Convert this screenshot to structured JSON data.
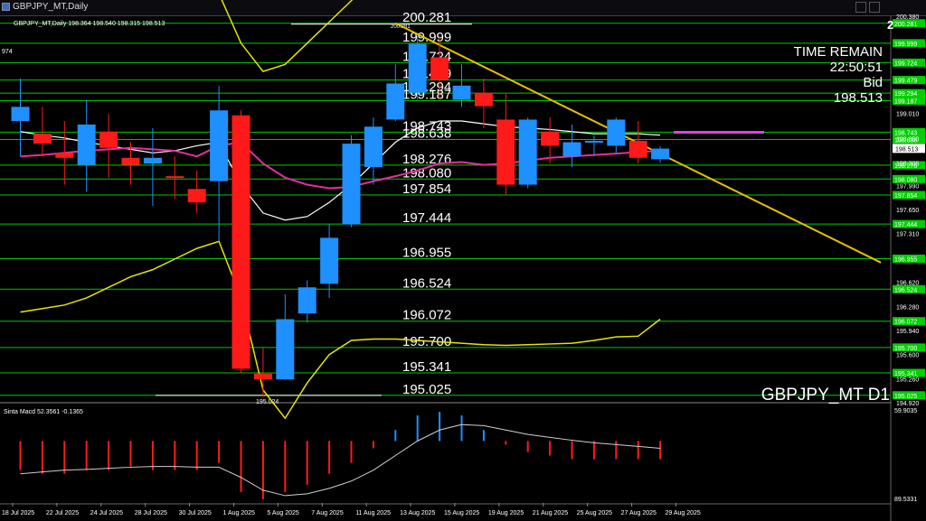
{
  "window": {
    "title": "GBPJPY_MT,Daily",
    "corner": "2"
  },
  "symbol_info": "GBPJPY_MT,Daily  198.364 198.540 198.315 198.513",
  "left_fragment": "974",
  "time_remain": {
    "label": "TIME REMAIN",
    "value": "22:50:51",
    "bid_label": "Bid",
    "bid": "198.513"
  },
  "watermark": "GBPJPY_MT D1",
  "indicator_label": "Sinta Macd 52.3561 -0.1365",
  "indicator_axis": [
    "59.9035",
    "89.5331"
  ],
  "colors": {
    "bull": "#1e90ff",
    "bear": "#ff1a1a",
    "level": "#00c800",
    "trend": "#e6c000",
    "band": "#e6e600",
    "mid": "#ffffff",
    "ma": "#e62e9e",
    "axis_bg": "#ffffff",
    "level_tag": "#00d000"
  },
  "chart_data": [
    {
      "type": "candlestick",
      "symbol": "GBPJPY_MT",
      "timeframe": "Daily",
      "x_tick_labels": [
        "18 Jul 2025",
        "22 Jul 2025",
        "24 Jul 2025",
        "28 Jul 2025",
        "30 Jul 2025",
        "1 Aug 2025",
        "5 Aug 2025",
        "7 Aug 2025",
        "11 Aug 2025",
        "13 Aug 2025",
        "15 Aug 2025",
        "19 Aug 2025",
        "21 Aug 2025",
        "25 Aug 2025",
        "27 Aug 2025",
        "29 Aug 2025"
      ],
      "ylim": [
        194.92,
        200.38
      ],
      "price_axis_ticks": [
        "200.380",
        "199.010",
        "198.650",
        "198.305",
        "197.990",
        "197.650",
        "197.310",
        "196.620",
        "196.280",
        "195.940",
        "195.600",
        "195.260",
        "194.920"
      ],
      "candles": [
        {
          "o": 198.9,
          "h": 199.5,
          "l": 198.4,
          "c": 199.1
        },
        {
          "o": 198.72,
          "h": 199.1,
          "l": 198.4,
          "c": 198.58
        },
        {
          "o": 198.45,
          "h": 198.9,
          "l": 198.0,
          "c": 198.38
        },
        {
          "o": 198.28,
          "h": 199.2,
          "l": 197.9,
          "c": 198.85
        },
        {
          "o": 198.75,
          "h": 199.0,
          "l": 198.1,
          "c": 198.52
        },
        {
          "o": 198.38,
          "h": 198.6,
          "l": 198.0,
          "c": 198.28
        },
        {
          "o": 198.3,
          "h": 198.8,
          "l": 197.7,
          "c": 198.38
        },
        {
          "o": 198.12,
          "h": 198.4,
          "l": 197.8,
          "c": 198.1
        },
        {
          "o": 197.94,
          "h": 198.2,
          "l": 197.6,
          "c": 197.75
        },
        {
          "o": 198.05,
          "h": 199.4,
          "l": 197.2,
          "c": 199.05
        },
        {
          "o": 198.98,
          "h": 199.05,
          "l": 195.34,
          "c": 195.4
        },
        {
          "o": 195.33,
          "h": 195.7,
          "l": 195.0,
          "c": 195.25
        },
        {
          "o": 195.25,
          "h": 196.45,
          "l": 195.24,
          "c": 196.1
        },
        {
          "o": 196.18,
          "h": 196.65,
          "l": 196.05,
          "c": 196.55
        },
        {
          "o": 196.6,
          "h": 197.45,
          "l": 196.4,
          "c": 197.25
        },
        {
          "o": 197.44,
          "h": 198.7,
          "l": 197.4,
          "c": 198.58
        },
        {
          "o": 198.25,
          "h": 198.95,
          "l": 198.0,
          "c": 198.82
        },
        {
          "o": 198.92,
          "h": 199.7,
          "l": 198.9,
          "c": 199.43
        },
        {
          "o": 199.3,
          "h": 200.1,
          "l": 199.2,
          "c": 199.99
        },
        {
          "o": 199.8,
          "h": 200.1,
          "l": 199.2,
          "c": 199.48
        },
        {
          "o": 199.2,
          "h": 199.7,
          "l": 199.1,
          "c": 199.4
        },
        {
          "o": 199.3,
          "h": 199.5,
          "l": 198.8,
          "c": 199.11
        },
        {
          "o": 198.92,
          "h": 199.3,
          "l": 197.85,
          "c": 198.0
        },
        {
          "o": 198.0,
          "h": 198.95,
          "l": 197.95,
          "c": 198.92
        },
        {
          "o": 198.75,
          "h": 198.95,
          "l": 198.3,
          "c": 198.55
        },
        {
          "o": 198.4,
          "h": 198.85,
          "l": 198.25,
          "c": 198.6
        },
        {
          "o": 198.6,
          "h": 198.7,
          "l": 198.4,
          "c": 198.62
        },
        {
          "o": 198.55,
          "h": 198.95,
          "l": 198.45,
          "c": 198.92
        },
        {
          "o": 198.62,
          "h": 198.9,
          "l": 198.3,
          "c": 198.38
        },
        {
          "o": 198.36,
          "h": 198.54,
          "l": 198.31,
          "c": 198.51
        }
      ],
      "levels": [
        200.281,
        199.999,
        199.724,
        199.479,
        199.294,
        199.187,
        198.743,
        198.638,
        198.276,
        198.08,
        197.854,
        197.444,
        196.955,
        196.524,
        196.072,
        195.7,
        195.341,
        195.025
      ],
      "level_labels": [
        "200.281",
        "199.999",
        "199.724",
        "199.479",
        "199.294",
        "199.187",
        "198.743",
        "198.638",
        "198.276",
        "198.080",
        "197.854",
        "197.444",
        "196.955",
        "196.524",
        "196.072",
        "195.700",
        "195.341",
        "195.025"
      ],
      "level_tags": [
        "200.281",
        "199.999",
        "199.724",
        "199.479",
        "199.294",
        "199.187",
        "198.743",
        "198.638",
        "198.276",
        "198.080",
        "197.854",
        "197.444",
        "196.955",
        "196.524",
        "196.072",
        "195.700",
        "195.341",
        "195.025"
      ],
      "bid_tag": "198.513",
      "high_marker": "200.281",
      "low_marker": "195.024",
      "upper_band": [
        201.3,
        201.1,
        201.0,
        200.95,
        200.92,
        200.9,
        200.92,
        200.95,
        201.0,
        200.7,
        200.0,
        199.6,
        199.7,
        200.0,
        200.3,
        200.6,
        200.9,
        201.1,
        201.3,
        201.45
      ],
      "mid_band": [
        198.75,
        198.7,
        198.66,
        198.6,
        198.55,
        198.5,
        198.45,
        198.48,
        198.55,
        198.6,
        198.0,
        197.6,
        197.5,
        197.55,
        197.75,
        198.0,
        198.3,
        198.6,
        198.8,
        198.9,
        198.9,
        198.86,
        198.82,
        198.8,
        198.78,
        198.75,
        198.72,
        198.72,
        198.72,
        198.7
      ],
      "ma_line": [
        198.4,
        198.42,
        198.45,
        198.48,
        198.5,
        198.52,
        198.5,
        198.48,
        198.4,
        198.55,
        198.6,
        198.3,
        198.1,
        198.0,
        197.95,
        197.97,
        198.05,
        198.12,
        198.2,
        198.3,
        198.32,
        198.28,
        198.3,
        198.34,
        198.38,
        198.4,
        198.42,
        198.44,
        198.46,
        198.48
      ],
      "lower_band": [
        196.2,
        196.25,
        196.3,
        196.4,
        196.55,
        196.7,
        196.8,
        196.95,
        197.1,
        197.2,
        196.4,
        195.1,
        194.7,
        195.2,
        195.6,
        195.8,
        195.82,
        195.82,
        195.8,
        195.78,
        195.76,
        195.74,
        195.73,
        195.74,
        195.75,
        195.76,
        195.8,
        195.85,
        195.86,
        196.1
      ],
      "trendline": {
        "from": [
          17,
          200.281
        ],
        "to": [
          39,
          196.9
        ]
      }
    },
    {
      "type": "histogram+line",
      "title": "Sinta Macd 52.3561 -0.1365",
      "histogram": [
        -0.8,
        -0.9,
        -0.9,
        -0.8,
        -0.8,
        -0.7,
        -0.8,
        -0.8,
        -0.8,
        -0.6,
        -1.4,
        -1.6,
        -1.4,
        -1.2,
        -0.9,
        -0.6,
        -0.2,
        0.3,
        0.7,
        0.8,
        0.7,
        0.3,
        -0.1,
        -0.3,
        -0.4,
        -0.5,
        -0.5,
        -0.5,
        -0.5,
        -0.5
      ],
      "signal": [
        -0.9,
        -0.85,
        -0.8,
        -0.78,
        -0.75,
        -0.72,
        -0.7,
        -0.7,
        -0.72,
        -0.72,
        -1.0,
        -1.35,
        -1.5,
        -1.45,
        -1.3,
        -1.1,
        -0.8,
        -0.4,
        0.0,
        0.3,
        0.45,
        0.42,
        0.3,
        0.18,
        0.1,
        0.02,
        -0.05,
        -0.1,
        -0.15,
        -0.2
      ],
      "ylim": [
        -1.7,
        1.0
      ]
    }
  ]
}
